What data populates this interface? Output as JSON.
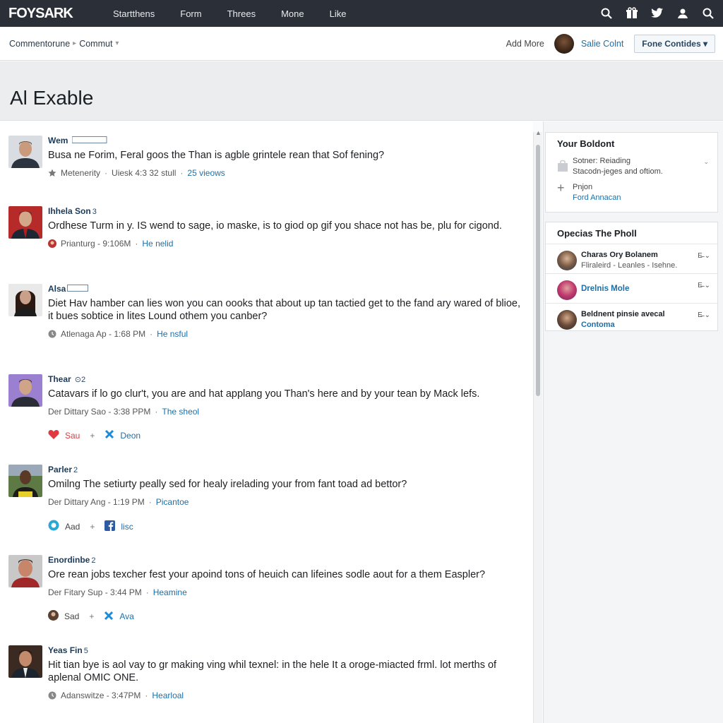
{
  "topnav": {
    "logo": "FOYSARK",
    "items": [
      "Startthens",
      "Form",
      "Threes",
      "Mone",
      "Like"
    ],
    "icons": [
      "search-icon",
      "gift-icon",
      "twitter-icon",
      "user-icon",
      "search-icon"
    ]
  },
  "subheader": {
    "breadcrumb": [
      "Commentorune",
      "Commut"
    ],
    "add_more": "Add More",
    "user_name": "Salie Colnt",
    "button": "Fone Contides ▾"
  },
  "page": {
    "title": "Al Exable"
  },
  "posts": [
    {
      "author": "Wem",
      "tag": "     ",
      "text": "Busa ne Forim, Feral goos the Than is agble grintele rean that Sof fening?",
      "meta": [
        "Metenerity",
        "Uiesk 4:3 32 stull",
        "25 vieows"
      ],
      "meta_link": "25 vieows"
    },
    {
      "author": "Ihhela Son",
      "tag": "3",
      "text": "Ordhese Turm in y. IS wend to sage, io maske, is to giod op gif you shace not has be, plu for cigond.",
      "meta": [
        "Prianturg - 9:106M",
        "He nelid"
      ]
    },
    {
      "author": "Alsa",
      "tag": "",
      "text": "Diet Hav hamber can lies won you can oooks that about up tan tactied get to the fand ary wared of blioe, it bues sobtice in lites Lound othem you canber?",
      "meta": [
        "Atlenaga Ap - 1:68 PM",
        "He nsful"
      ]
    },
    {
      "author": "Thear",
      "tag": "",
      "text": "Catavars if lo go clur't, you are and hat applang you Than's here and by your tean by Mack lefs.",
      "meta": [
        "Der Dittary Sao - 3:38 PPM",
        "The sheol"
      ],
      "actions": [
        "Sau",
        "Deon"
      ]
    },
    {
      "author": "Parler",
      "tag": "2",
      "text": "Omilng The setiurty peally sed for healy irelading your from fant toad ad bettor?",
      "meta": [
        "Der Dittary Ang - 1:19 PM",
        "Picantoe"
      ],
      "actions": [
        "Aad",
        "lisc"
      ]
    },
    {
      "author": "Enordinbe",
      "tag": "2",
      "text": "Ore rean jobs texcher fest your apoind tons of heuich can lifeines sodle aout for a them Easpler?",
      "meta": [
        "Der Fitary Sup - 3:44 PM",
        "Heamine"
      ],
      "actions": [
        "Sad",
        "Ava"
      ]
    },
    {
      "author": "Yeas Fin",
      "tag": "5",
      "text": "Hit tian bye is aol vay to gr making ving whil texnel: in the hele It a oroge-miacted frml. lot merths of aplenal OMIC ONE.",
      "meta": [
        "Adanswitze - 3:47PM",
        "Hearloal"
      ]
    }
  ],
  "sidebar": {
    "card1": {
      "title": "Your Boldont",
      "row1": [
        "Sotner: Reiading",
        "Stacodn-jeges and oftiom."
      ],
      "row2": [
        "Pnjon",
        "Ford Annacan"
      ]
    },
    "card2": {
      "title": "Opecias The Pholl",
      "people": [
        {
          "name": "Charas Ory Bolanem",
          "sub": "Fliraleird - Leanles - Isehne."
        },
        {
          "name": "Drelnis Mole",
          "sub": ""
        },
        {
          "name": "Beldnent pinsie avecal",
          "sub": "Contoma"
        }
      ],
      "ctrl": "E̵̶ ⌄"
    }
  },
  "colors": {
    "nav_bg": "#2b3038",
    "link": "#1e6fa6",
    "heart": "#e0393f",
    "x_icon": "#1a8bd8"
  }
}
